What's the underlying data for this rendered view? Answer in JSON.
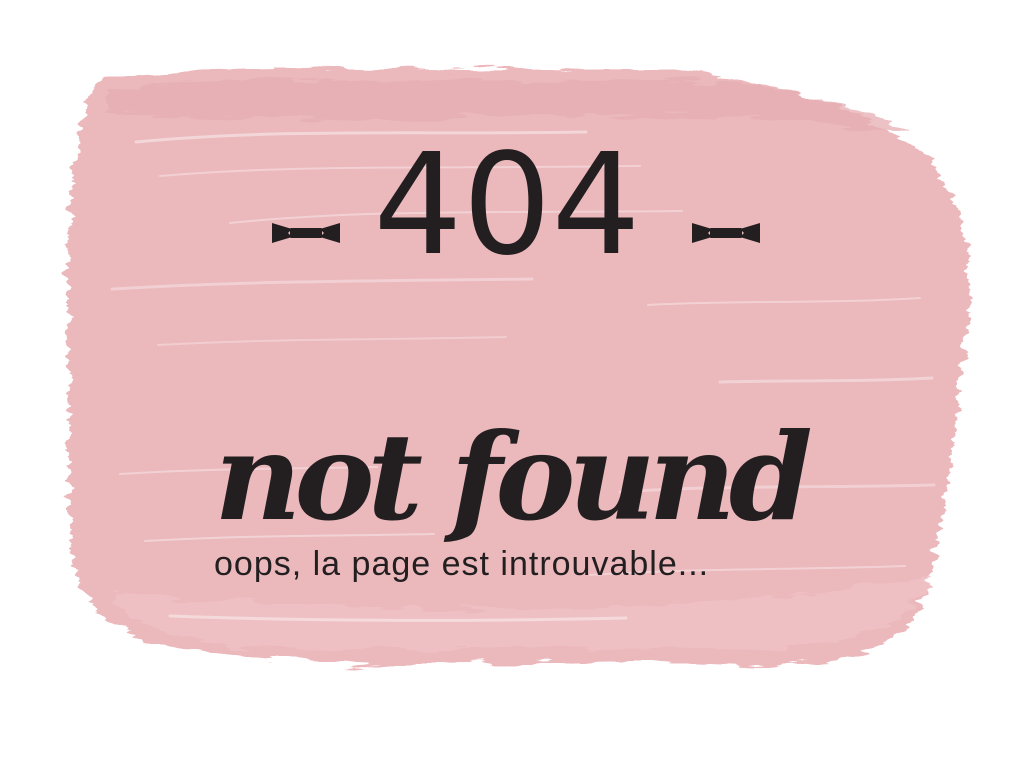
{
  "page": {
    "code": "404",
    "subtitle": "not found",
    "message": "oops, la page est introuvable..."
  },
  "colors": {
    "background": "#ffffff",
    "brush": "#ebb8bc",
    "brush_light": "#f3d1d3",
    "ink": "#231f20"
  },
  "icons": {
    "left_ribbon": "ribbon-bow-icon",
    "right_ribbon": "ribbon-bow-icon"
  }
}
